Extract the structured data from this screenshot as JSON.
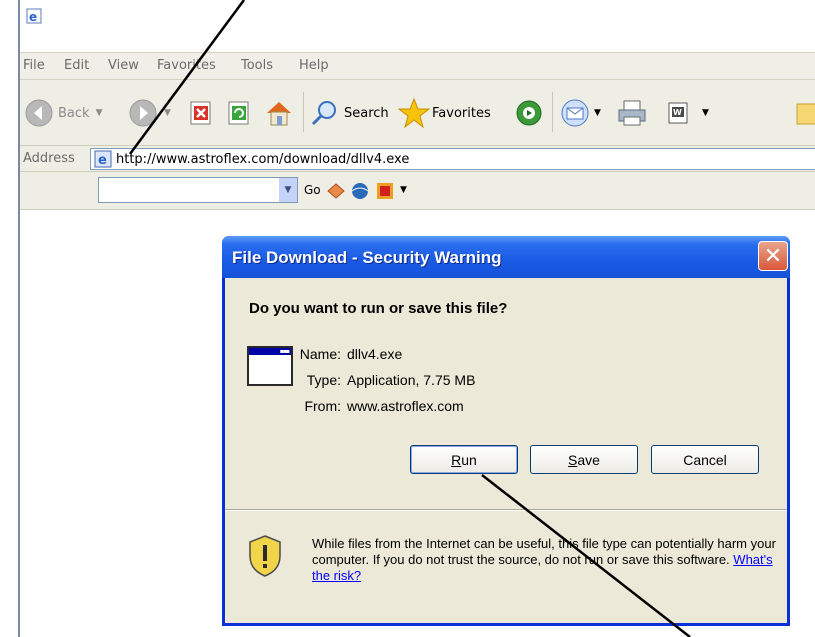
{
  "browser": {
    "menu": [
      "File",
      "Edit",
      "View",
      "Favorites",
      "Tools",
      "Help"
    ],
    "toolbar": {
      "back_label": "Back",
      "search_label": "Search",
      "favorites_label": "Favorites"
    },
    "address": {
      "label": "Address",
      "url": "http://www.astroflex.com/download/dllv4.exe"
    },
    "links": {
      "go_label": "Go"
    }
  },
  "dialog": {
    "title": "File Download - Security Warning",
    "question": "Do you want to run or save this file?",
    "name_key": "Name:",
    "name_val": "dllv4.exe",
    "type_key": "Type:",
    "type_val": "Application, 7.75 MB",
    "from_key": "From:",
    "from_val": "www.astroflex.com",
    "run_label_u": "R",
    "run_label_rest": "un",
    "save_label_u": "S",
    "save_label_rest": "ave",
    "cancel_label": "Cancel",
    "warning_text": "While files from the Internet can be useful, this file type can potentially harm your computer. If you do not trust the source, do not run or save this software.",
    "warning_link": "What's the risk?"
  },
  "colors": {
    "dialog_title_blue": "#1a5ae3",
    "dialog_body": "#ece9d8",
    "close_red": "#d9573a",
    "link_blue": "#0000ff"
  }
}
